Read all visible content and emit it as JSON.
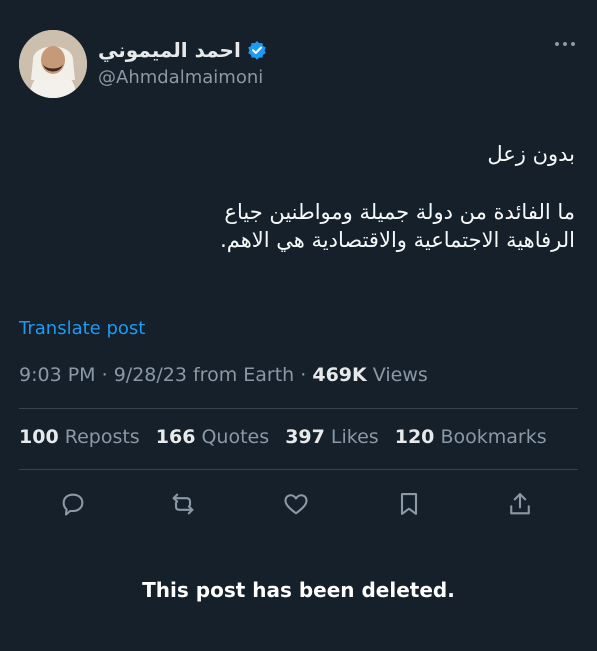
{
  "author": {
    "display_name": "احمد الميموني",
    "handle": "@Ahmdalmaimoni",
    "verified": true,
    "avatar": "avatar-photo"
  },
  "tweet": {
    "line1": "بدون زعل",
    "line2": "ما الفائدة من دولة جميلة ومواطنين جياع",
    "line3": "الرفاهية الاجتماعية والاقتصادية هي الاهم."
  },
  "translate_label": "Translate post",
  "meta": {
    "time": "9:03 PM",
    "date": "9/28/23 from Earth",
    "views_count": "469K",
    "views_label": "Views"
  },
  "stats": {
    "reposts_count": "100",
    "reposts_label": "Reposts",
    "quotes_count": "166",
    "quotes_label": "Quotes",
    "likes_count": "397",
    "likes_label": "Likes",
    "bookmarks_count": "120",
    "bookmarks_label": "Bookmarks"
  },
  "actions": [
    "reply-icon",
    "repost-icon",
    "like-icon",
    "bookmark-icon",
    "share-icon"
  ],
  "deleted_notice": "This post has been deleted.",
  "colors": {
    "background": "#15202b",
    "accent": "#1d9bf0",
    "muted": "#8b98a5"
  }
}
